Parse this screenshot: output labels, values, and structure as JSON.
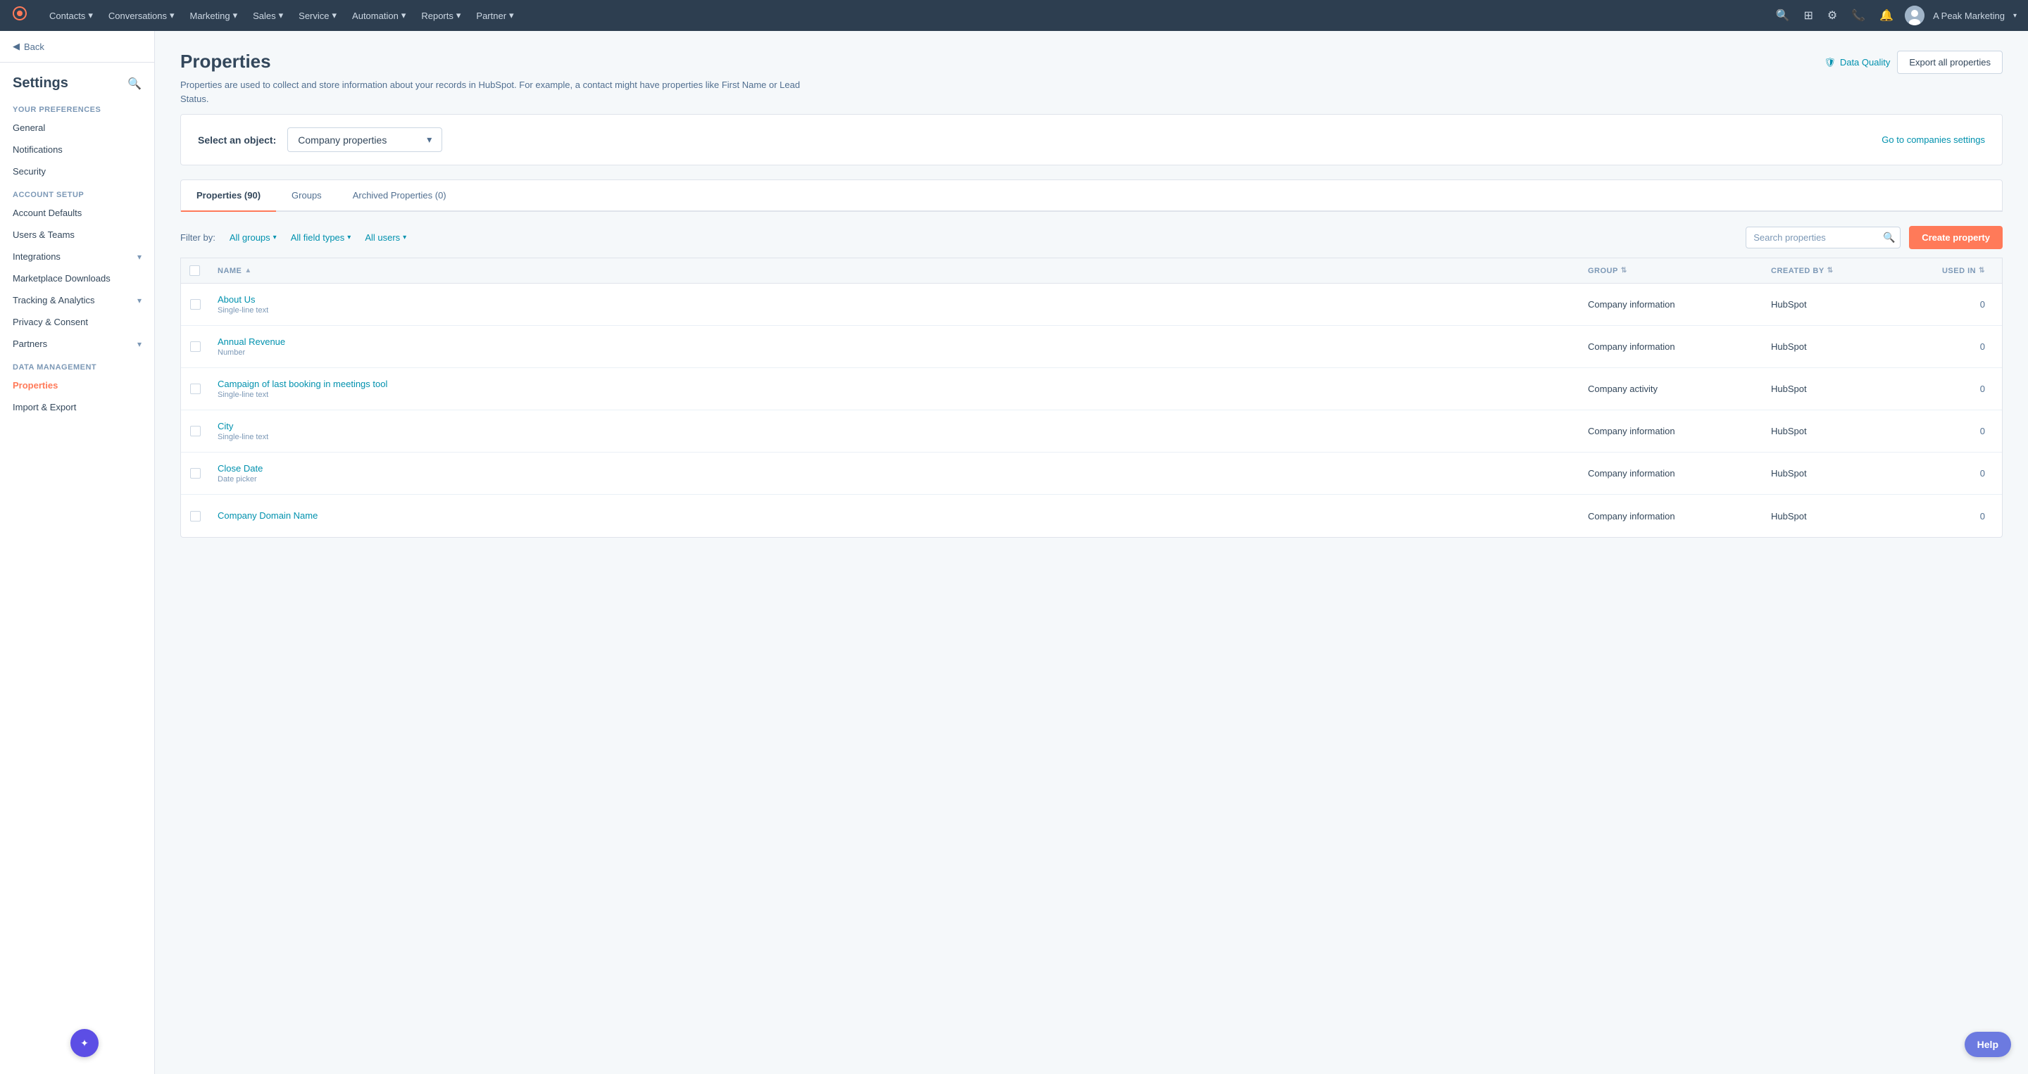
{
  "topnav": {
    "logo": "⬡",
    "nav_items": [
      {
        "label": "Contacts",
        "id": "contacts"
      },
      {
        "label": "Conversations",
        "id": "conversations"
      },
      {
        "label": "Marketing",
        "id": "marketing"
      },
      {
        "label": "Sales",
        "id": "sales"
      },
      {
        "label": "Service",
        "id": "service"
      },
      {
        "label": "Automation",
        "id": "automation"
      },
      {
        "label": "Reports",
        "id": "reports"
      },
      {
        "label": "Partner",
        "id": "partner"
      }
    ],
    "account_name": "A Peak Marketing"
  },
  "sidebar": {
    "back_label": "Back",
    "title": "Settings",
    "your_preferences_label": "Your Preferences",
    "items_preferences": [
      {
        "label": "General",
        "id": "general"
      },
      {
        "label": "Notifications",
        "id": "notifications"
      },
      {
        "label": "Security",
        "id": "security"
      }
    ],
    "account_setup_label": "Account Setup",
    "items_account": [
      {
        "label": "Account Defaults",
        "id": "account-defaults"
      },
      {
        "label": "Users & Teams",
        "id": "users-teams"
      },
      {
        "label": "Integrations",
        "id": "integrations",
        "has_chevron": true
      },
      {
        "label": "Marketplace Downloads",
        "id": "marketplace"
      },
      {
        "label": "Tracking & Analytics",
        "id": "tracking",
        "has_chevron": true
      },
      {
        "label": "Privacy & Consent",
        "id": "privacy"
      },
      {
        "label": "Partners",
        "id": "partners",
        "has_chevron": true
      }
    ],
    "data_management_label": "Data Management",
    "items_data": [
      {
        "label": "Properties",
        "id": "properties",
        "active": true
      },
      {
        "label": "Import & Export",
        "id": "import-export"
      }
    ]
  },
  "page": {
    "title": "Properties",
    "description": "Properties are used to collect and store information about your records in HubSpot. For example, a contact might have properties like First Name or Lead Status.",
    "data_quality_label": "Data Quality",
    "export_label": "Export all properties",
    "select_object_label": "Select an object:",
    "object_selected": "Company properties",
    "go_to_settings_label": "Go to companies settings",
    "tabs": [
      {
        "label": "Properties (90)",
        "id": "properties",
        "active": true
      },
      {
        "label": "Groups",
        "id": "groups"
      },
      {
        "label": "Archived Properties (0)",
        "id": "archived"
      }
    ],
    "filter_by_label": "Filter by:",
    "filter_all_groups": "All groups",
    "filter_all_field_types": "All field types",
    "filter_all_users": "All users",
    "search_placeholder": "Search properties",
    "create_property_label": "Create property",
    "table": {
      "headers": [
        {
          "label": "NAME",
          "id": "name",
          "sortable": true
        },
        {
          "label": "GROUP",
          "id": "group",
          "sortable": true
        },
        {
          "label": "CREATED BY",
          "id": "created_by",
          "sortable": true
        },
        {
          "label": "USED IN",
          "id": "used_in",
          "sortable": true
        }
      ],
      "rows": [
        {
          "name": "About Us",
          "type": "Single-line text",
          "group": "Company information",
          "created_by": "HubSpot",
          "used_in": "0"
        },
        {
          "name": "Annual Revenue",
          "type": "Number",
          "group": "Company information",
          "created_by": "HubSpot",
          "used_in": "0"
        },
        {
          "name": "Campaign of last booking in meetings tool",
          "type": "Single-line text",
          "group": "Company activity",
          "created_by": "HubSpot",
          "used_in": "0"
        },
        {
          "name": "City",
          "type": "Single-line text",
          "group": "Company information",
          "created_by": "HubSpot",
          "used_in": "0"
        },
        {
          "name": "Close Date",
          "type": "Date picker",
          "group": "Company information",
          "created_by": "HubSpot",
          "used_in": "0"
        },
        {
          "name": "Company Domain Name",
          "type": "",
          "group": "Company information",
          "created_by": "HubSpot",
          "used_in": "0"
        }
      ]
    }
  },
  "help_label": "Help",
  "ai_widget_icon": "✦"
}
